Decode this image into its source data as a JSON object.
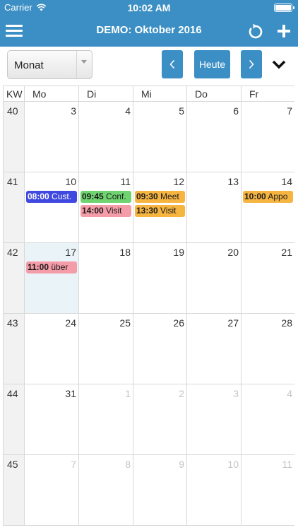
{
  "status_bar": {
    "carrier": "Carrier",
    "time": "10:02 AM"
  },
  "navbar": {
    "title": "DEMO: Oktober 2016",
    "menu_icon": "hamburger-icon",
    "refresh_icon": "refresh-icon",
    "add_icon": "plus-icon"
  },
  "toolbar": {
    "view_selected": "Monat",
    "prev_label": "‹",
    "today_label": "Heute",
    "next_label": "›",
    "collapse_icon": "chevron-down-icon"
  },
  "colors": {
    "accent": "#3c8fc4",
    "event_blue": "#3f49e0",
    "event_green": "#6fd36f",
    "event_pink": "#f59ca9",
    "event_orange": "#f6b441",
    "today_bg": "#eaf3f8"
  },
  "calendar": {
    "headers": [
      "KW",
      "Mo",
      "Di",
      "Mi",
      "Do",
      "Fr"
    ],
    "weeks": [
      {
        "kw": "40",
        "days": [
          {
            "num": "3",
            "other": false,
            "today": false,
            "events": []
          },
          {
            "num": "4",
            "other": false,
            "today": false,
            "events": []
          },
          {
            "num": "5",
            "other": false,
            "today": false,
            "events": []
          },
          {
            "num": "6",
            "other": false,
            "today": false,
            "events": []
          },
          {
            "num": "7",
            "other": false,
            "today": false,
            "events": []
          }
        ]
      },
      {
        "kw": "41",
        "days": [
          {
            "num": "10",
            "other": false,
            "today": false,
            "events": [
              {
                "time": "08:00",
                "title": "Cust.",
                "color": "blue"
              }
            ]
          },
          {
            "num": "11",
            "other": false,
            "today": false,
            "events": [
              {
                "time": "09:45",
                "title": "Conf.",
                "color": "green"
              },
              {
                "time": "14:00",
                "title": "Visit",
                "color": "pink"
              }
            ]
          },
          {
            "num": "12",
            "other": false,
            "today": false,
            "events": [
              {
                "time": "09:30",
                "title": "Meet",
                "color": "orange"
              },
              {
                "time": "13:30",
                "title": "Visit",
                "color": "orange"
              }
            ]
          },
          {
            "num": "13",
            "other": false,
            "today": false,
            "events": []
          },
          {
            "num": "14",
            "other": false,
            "today": false,
            "events": [
              {
                "time": "10:00",
                "title": "Appo",
                "color": "orange"
              }
            ]
          }
        ]
      },
      {
        "kw": "42",
        "days": [
          {
            "num": "17",
            "other": false,
            "today": true,
            "events": [
              {
                "time": "11:00",
                "title": "über",
                "color": "pink"
              }
            ]
          },
          {
            "num": "18",
            "other": false,
            "today": false,
            "events": []
          },
          {
            "num": "19",
            "other": false,
            "today": false,
            "events": []
          },
          {
            "num": "20",
            "other": false,
            "today": false,
            "events": []
          },
          {
            "num": "21",
            "other": false,
            "today": false,
            "events": []
          }
        ]
      },
      {
        "kw": "43",
        "days": [
          {
            "num": "24",
            "other": false,
            "today": false,
            "events": []
          },
          {
            "num": "25",
            "other": false,
            "today": false,
            "events": []
          },
          {
            "num": "26",
            "other": false,
            "today": false,
            "events": []
          },
          {
            "num": "27",
            "other": false,
            "today": false,
            "events": []
          },
          {
            "num": "28",
            "other": false,
            "today": false,
            "events": []
          }
        ]
      },
      {
        "kw": "44",
        "days": [
          {
            "num": "31",
            "other": false,
            "today": false,
            "events": []
          },
          {
            "num": "1",
            "other": true,
            "today": false,
            "events": []
          },
          {
            "num": "2",
            "other": true,
            "today": false,
            "events": []
          },
          {
            "num": "3",
            "other": true,
            "today": false,
            "events": []
          },
          {
            "num": "4",
            "other": true,
            "today": false,
            "events": []
          }
        ]
      },
      {
        "kw": "45",
        "days": [
          {
            "num": "7",
            "other": true,
            "today": false,
            "events": []
          },
          {
            "num": "8",
            "other": true,
            "today": false,
            "events": []
          },
          {
            "num": "9",
            "other": true,
            "today": false,
            "events": []
          },
          {
            "num": "10",
            "other": true,
            "today": false,
            "events": []
          },
          {
            "num": "11",
            "other": true,
            "today": false,
            "events": []
          }
        ]
      }
    ]
  }
}
